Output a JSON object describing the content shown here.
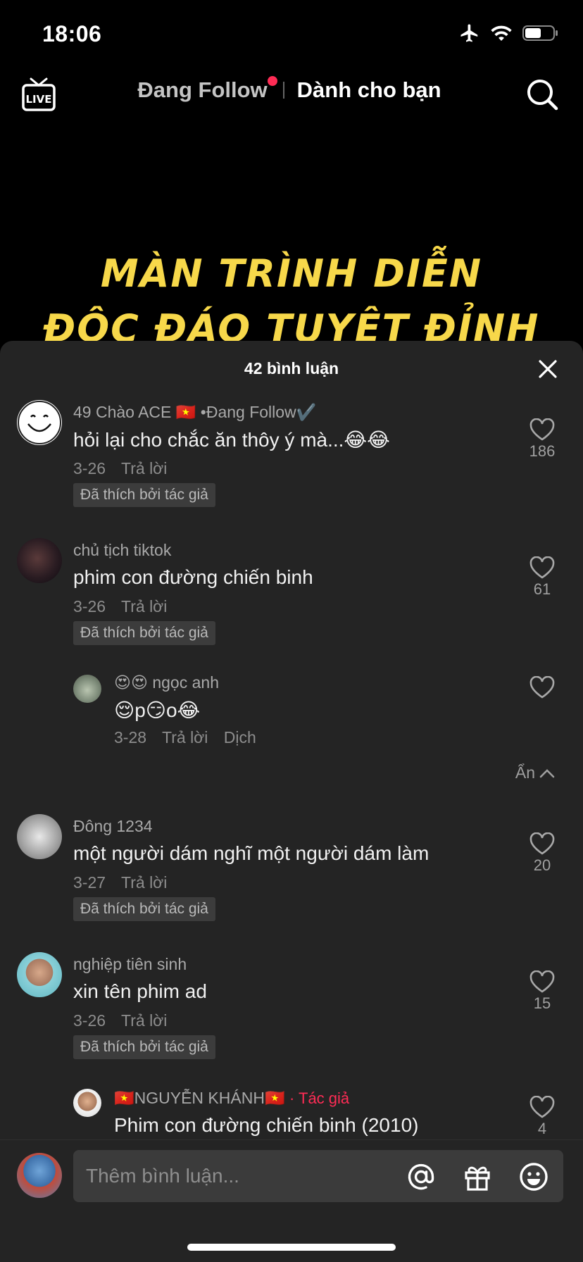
{
  "status_bar": {
    "time": "18:06",
    "icons": [
      "airplane-icon",
      "wifi-icon",
      "battery-icon"
    ]
  },
  "nav": {
    "live_label": "LIVE",
    "tab_following": "Đang Follow",
    "tab_for_you": "Dành cho bạn",
    "accent": "#fe2c55"
  },
  "video": {
    "title_line1": "MÀN TRÌNH DIỄN",
    "title_line2": "ĐỘC ĐÁO TUYỆT ĐỈNH",
    "title_color": "#f7d84a"
  },
  "sheet": {
    "comment_count": "42 bình luận",
    "comments": [
      {
        "user": "49 Chào ACE 🇻🇳 •Đang Follow✔️",
        "text": "hỏi lại cho chắc ăn thôy ý mà...😂😂",
        "date": "3-26",
        "reply": "Trả lời",
        "liked_by_author": "Đã thích bởi tác giả",
        "likes": "186"
      },
      {
        "user": "chủ tịch tiktok",
        "text": "phim con đường chiến binh",
        "date": "3-26",
        "reply": "Trả lời",
        "liked_by_author": "Đã thích bởi tác giả",
        "likes": "61"
      },
      {
        "user": "😍😍 ngọc anh",
        "text": "😌p😏o😂",
        "date": "3-28",
        "reply": "Trả lời",
        "translate": "Dịch",
        "likes": ""
      },
      {
        "user": "Đông 1234",
        "text": "một người dám nghĩ một người dám làm",
        "date": "3-27",
        "reply": "Trả lời",
        "liked_by_author": "Đã thích bởi tác giả",
        "likes": "20"
      },
      {
        "user": "nghiệp tiên sinh",
        "text": "xin tên phim ad",
        "date": "3-26",
        "reply": "Trả lời",
        "liked_by_author": "Đã thích bởi tác giả",
        "likes": "15"
      },
      {
        "user": "🇻🇳NGUYỄN KHÁNH🇻🇳",
        "author_tag": "· Tác giả",
        "text": "Phim con đường chiến binh (2010)",
        "likes": "4"
      }
    ],
    "hide_label": "Ẩn"
  },
  "composer": {
    "placeholder": "Thêm bình luận...",
    "icons": [
      "mention-icon",
      "gift-icon",
      "emoji-icon"
    ]
  }
}
